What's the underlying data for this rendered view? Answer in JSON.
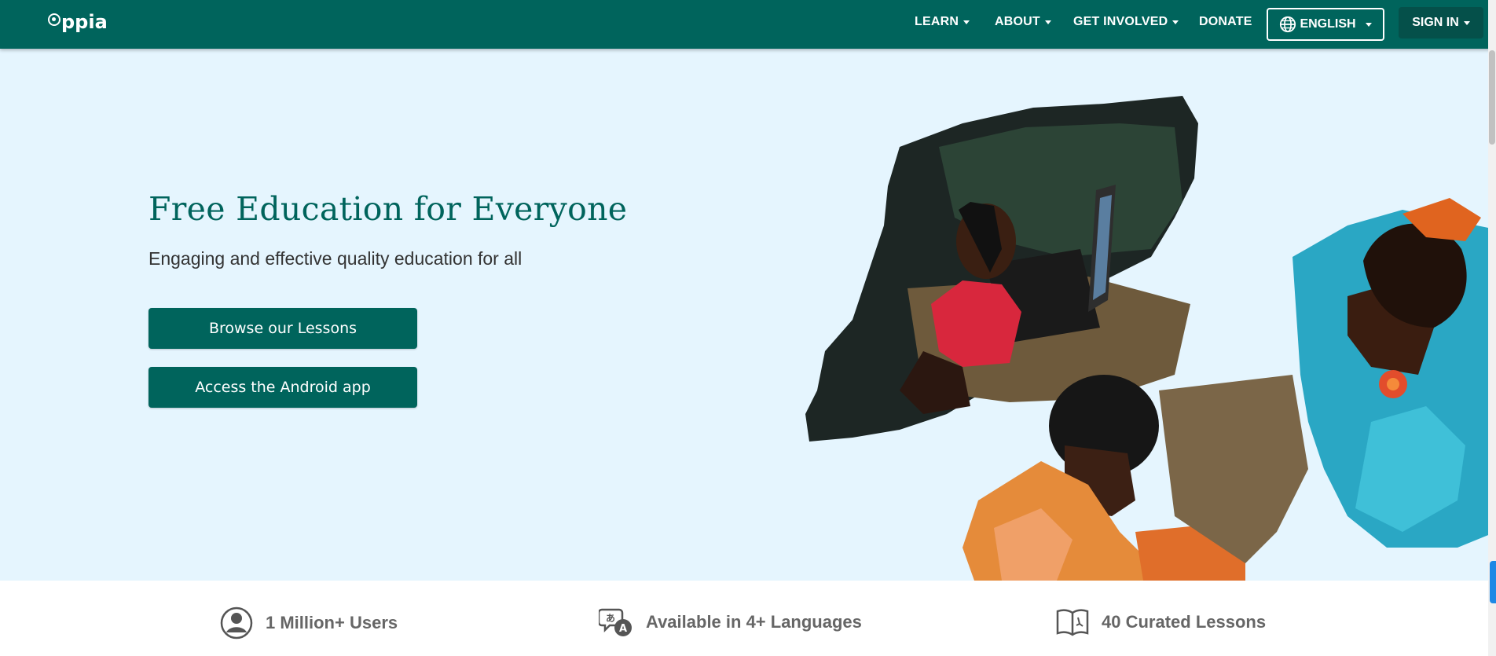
{
  "nav": {
    "logo": "ppia",
    "items": [
      {
        "label": "LEARN"
      },
      {
        "label": "ABOUT"
      },
      {
        "label": "GET INVOLVED"
      },
      {
        "label": "DONATE"
      }
    ],
    "language": "ENGLISH",
    "sign_in": "SIGN IN"
  },
  "hero": {
    "title": "Free Education for Everyone",
    "subtitle": "Engaging and effective quality education for all",
    "browse_button": "Browse our Lessons",
    "android_button": "Access the Android app"
  },
  "stats": [
    {
      "icon": "user-icon",
      "label": "1 Million+ Users"
    },
    {
      "icon": "translate-icon",
      "label": "Available in 4+ Languages"
    },
    {
      "icon": "book-icon",
      "label": "40 Curated Lessons"
    }
  ],
  "colors": {
    "brand": "#00645c",
    "hero_bg": "#e5f5fe",
    "signin_bg": "#05504a"
  }
}
